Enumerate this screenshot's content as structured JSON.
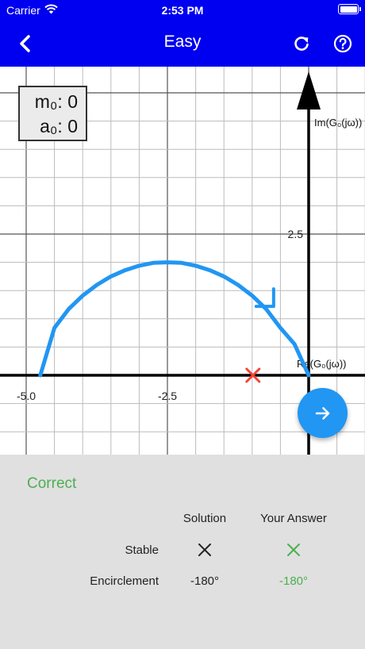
{
  "status": {
    "carrier": "Carrier",
    "time": "2:53 PM"
  },
  "nav": {
    "title": "Easy",
    "back_icon": "chevron-left-icon",
    "refresh_icon": "refresh-icon",
    "help_icon": "help-icon"
  },
  "counter": {
    "m_label": "m₀: 0",
    "a_label": "a₀: 0"
  },
  "chart_data": {
    "type": "line",
    "xlim": [
      -6.1,
      1.7
    ],
    "ylim": [
      -1.7,
      6.7
    ],
    "grid": true,
    "xticks": [
      {
        "value": -5.0,
        "label": "-5.0"
      },
      {
        "value": -2.5,
        "label": "-2.5"
      }
    ],
    "yticks": [
      {
        "value": 2.5,
        "label": "2.5"
      }
    ],
    "xlabel": "Re(G₀(jω))",
    "ylabel": "Im(G₀(jω))",
    "series": [
      {
        "x": [
          -4.75,
          -4.5,
          -4.25,
          -4.0,
          -3.75,
          -3.5,
          -3.25,
          -3.0,
          -2.75,
          -2.5,
          -2.25,
          -2.0,
          -1.75,
          -1.5,
          -1.25,
          -1.0,
          -0.75,
          -0.5,
          -0.25,
          0.0
        ],
        "y": [
          0.0,
          0.84,
          1.17,
          1.41,
          1.6,
          1.75,
          1.86,
          1.94,
          1.99,
          2.0,
          1.99,
          1.94,
          1.86,
          1.75,
          1.6,
          1.41,
          1.17,
          0.84,
          0.55,
          0.0
        ],
        "color": "#2196f3"
      }
    ],
    "direction_marker": {
      "x": -0.62,
      "y": 1.22
    },
    "critical_point": {
      "x": -1.0,
      "y": 0.0,
      "color": "#f44336"
    }
  },
  "result": {
    "title": "Correct",
    "columns": [
      "Solution",
      "Your Answer"
    ],
    "rows": [
      {
        "label": "Stable",
        "solution": "✕",
        "answer": "✕"
      },
      {
        "label": "Encirclement",
        "solution": "-180°",
        "answer": "-180°"
      }
    ],
    "correct_color": "#4caf50"
  },
  "fab": {
    "icon": "arrow-right-icon"
  }
}
